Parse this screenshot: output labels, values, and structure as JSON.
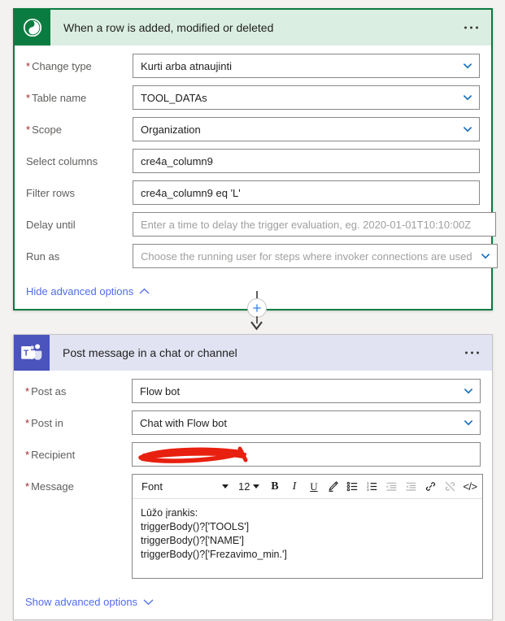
{
  "trigger_card": {
    "icon": "dataverse-icon",
    "icon_color": "#0b7c41",
    "header_bg": "#daeee2",
    "title": "When a row is added, modified or deleted",
    "overflow_label": "more-commands",
    "fields": [
      {
        "label": "Change type",
        "required": true,
        "value": "Kurti arba atnaujinti",
        "is_placeholder": false,
        "has_chevron": true
      },
      {
        "label": "Table name",
        "required": true,
        "value": "TOOL_DATAs",
        "is_placeholder": false,
        "has_chevron": true
      },
      {
        "label": "Scope",
        "required": true,
        "value": "Organization",
        "is_placeholder": false,
        "has_chevron": true
      },
      {
        "label": "Select columns",
        "required": false,
        "value": "cre4a_column9",
        "is_placeholder": false,
        "has_chevron": false
      },
      {
        "label": "Filter rows",
        "required": false,
        "value": "cre4a_column9 eq 'L'",
        "is_placeholder": false,
        "has_chevron": false
      },
      {
        "label": "Delay until",
        "required": false,
        "value": "Enter a time to delay the trigger evaluation, eg. 2020-01-01T10:10:00Z",
        "is_placeholder": true,
        "has_chevron": false
      },
      {
        "label": "Run as",
        "required": false,
        "value": "Choose the running user for steps where invoker connections are used",
        "is_placeholder": true,
        "has_chevron": true
      }
    ],
    "advanced_link": "Hide advanced options",
    "advanced_state": "expanded"
  },
  "connector": {
    "add_button_label": "Insert a new step",
    "icon": "plus-icon",
    "plus_color": "#4f8fe0"
  },
  "action_card": {
    "icon": "teams-icon",
    "icon_color": "#4b53bc",
    "header_bg": "#e1e2f2",
    "title": "Post message in a chat or channel",
    "overflow_label": "more-commands",
    "fields": [
      {
        "label": "Post as",
        "required": true,
        "value": "Flow bot",
        "is_placeholder": false,
        "has_chevron": true
      },
      {
        "label": "Post in",
        "required": true,
        "value": "Chat with Flow bot",
        "is_placeholder": false,
        "has_chevron": true
      },
      {
        "label": "Recipient",
        "required": true,
        "value": "",
        "is_placeholder": false,
        "has_chevron": false,
        "redacted": true
      }
    ],
    "message_field": {
      "label": "Message",
      "required": true,
      "toolbar": {
        "font_label": "Font",
        "size_label": "12",
        "bold": "B",
        "italic": "I",
        "underline": "U",
        "highlight_icon": "pen-highlight-icon",
        "bulleted_list_icon": "bulleted-list-icon",
        "numbered_list_icon": "numbered-list-icon",
        "indent_icon": "increase-indent-icon",
        "outdent_icon": "decrease-indent-icon",
        "link_icon": "link-icon",
        "unlink_icon": "unlink-icon",
        "code_label": "</>"
      },
      "body_lines": [
        "Lūžo įrankis:",
        "triggerBody()?['TOOLS']",
        "triggerBody()?['NAME']",
        "triggerBody()?['Frezavimo_min.']"
      ]
    },
    "advanced_link": "Show advanced options",
    "advanced_state": "collapsed"
  },
  "colors": {
    "accent_blue": "#0f6cbd",
    "link_blue": "#4f6bed",
    "required_red": "#a4262c",
    "redaction_red": "#e8200f"
  }
}
